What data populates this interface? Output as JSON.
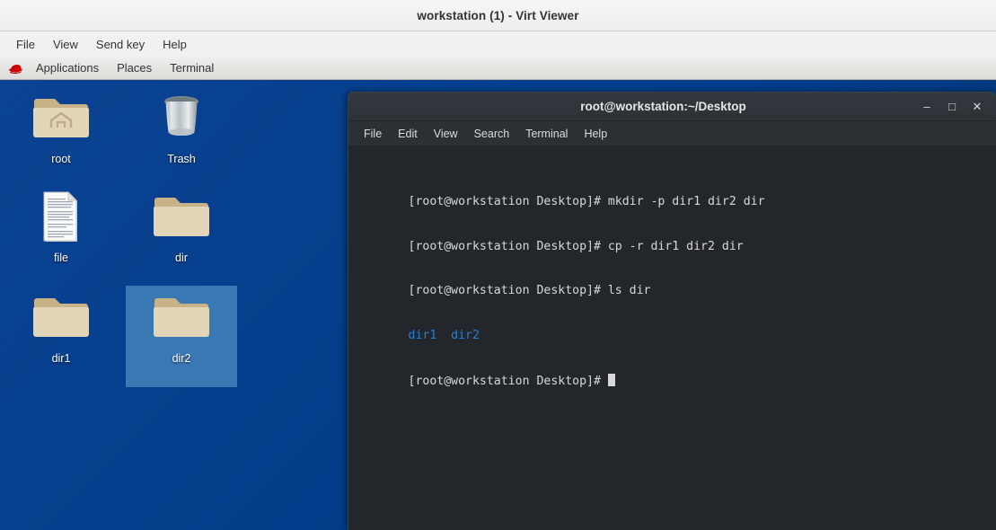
{
  "viewer": {
    "title": "workstation (1) - Virt Viewer",
    "menu": [
      "File",
      "View",
      "Send key",
      "Help"
    ]
  },
  "gnome_panel": {
    "logo_icon": "redhat-fedora-icon",
    "items": [
      "Applications",
      "Places",
      "Terminal"
    ]
  },
  "desktop": {
    "background_color": "#023d8a",
    "selection_color": "#3a78b4",
    "icons": [
      {
        "label": "root",
        "icon": "home-folder-icon",
        "selected": false
      },
      {
        "label": "Trash",
        "icon": "trash-can-icon",
        "selected": false
      },
      {
        "label": "file",
        "icon": "text-document-icon",
        "selected": false
      },
      {
        "label": "dir",
        "icon": "folder-icon",
        "selected": false
      },
      {
        "label": "dir1",
        "icon": "folder-icon",
        "selected": false
      },
      {
        "label": "dir2",
        "icon": "folder-icon",
        "selected": true
      }
    ]
  },
  "terminal": {
    "title": "root@workstation:~/Desktop",
    "menu": [
      "File",
      "Edit",
      "View",
      "Search",
      "Terminal",
      "Help"
    ],
    "window_buttons": {
      "minimize": "–",
      "maximize": "□",
      "close": "✕"
    },
    "colors": {
      "background": "#23272b",
      "foreground": "#d8d8d8",
      "dir_blue": "#2a7fd4"
    },
    "lines": [
      {
        "prompt": "[root@workstation Desktop]# ",
        "command": "mkdir -p dir1 dir2 dir"
      },
      {
        "prompt": "[root@workstation Desktop]# ",
        "command": "cp -r dir1 dir2 dir"
      },
      {
        "prompt": "[root@workstation Desktop]# ",
        "command": "ls dir"
      }
    ],
    "output_line": "dir1  dir2",
    "final_prompt": "[root@workstation Desktop]# "
  }
}
